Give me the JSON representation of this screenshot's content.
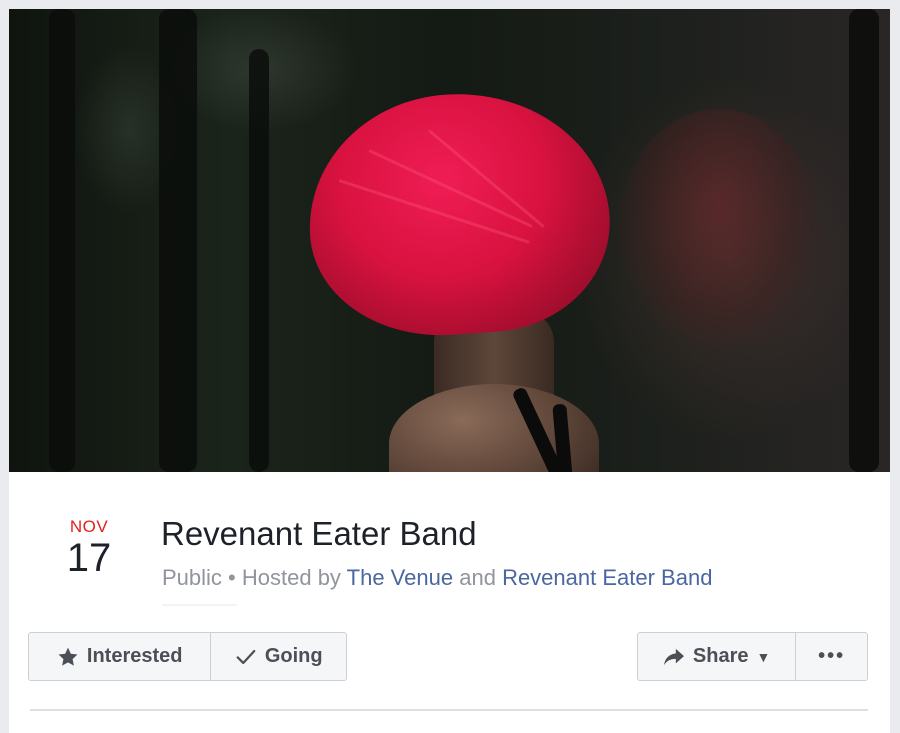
{
  "event": {
    "month": "NOV",
    "day": "17",
    "title": "Revenant Eater Band",
    "privacy": "Public",
    "hosted_by_prefix": "Hosted by",
    "host_1": "The Venue",
    "joiner": "and",
    "host_2": "Revenant Eater Band"
  },
  "actions": {
    "interested_label": "Interested",
    "interested_icon": "star-icon",
    "going_label": "Going",
    "going_icon": "checkmark-icon",
    "share_label": "Share",
    "share_icon": "share-arrow-icon",
    "more_label": "•••"
  },
  "colors": {
    "date_month": "#e0201f",
    "link": "#4b67a1",
    "muted_text": "#90949c",
    "button_bg": "#f5f6f7",
    "hair": "#d8123f"
  }
}
